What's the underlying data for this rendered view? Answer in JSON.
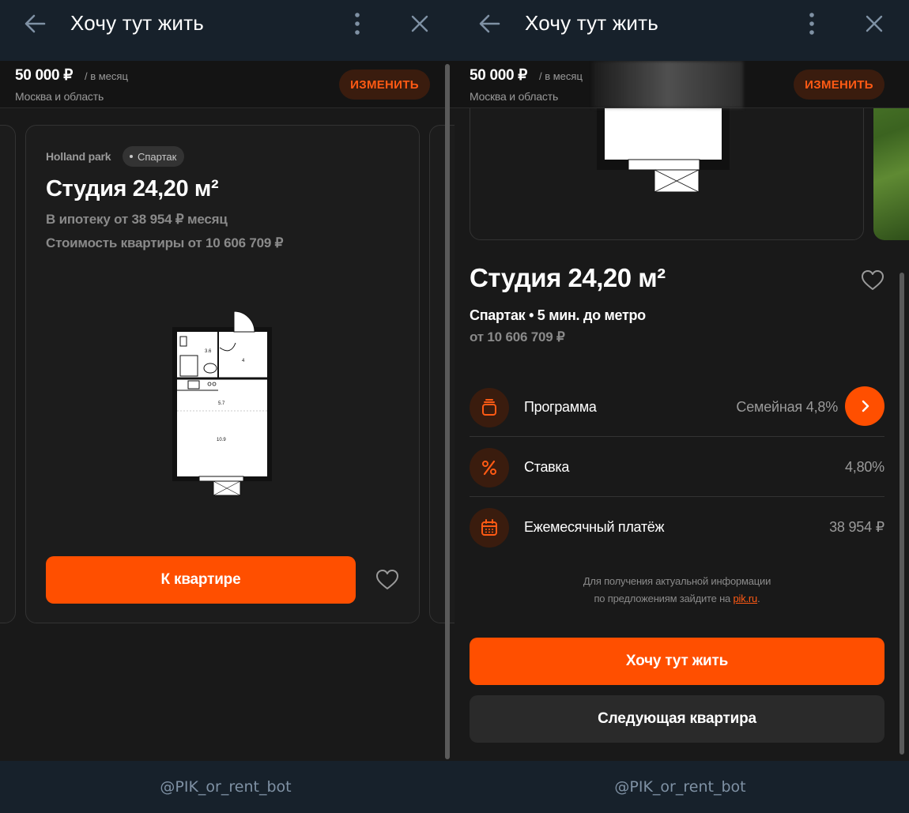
{
  "telegram": {
    "title": "Хочу тут жить",
    "bot_username": "@PIK_or_rent_bot"
  },
  "filter_bar": {
    "price": "50 000 ₽",
    "period": "/ в месяц",
    "region": "Москва и область",
    "change_label": "ИЗМЕНИТЬ"
  },
  "card": {
    "project": "Holland park",
    "metro": "Спартак",
    "title": "Студия 24,20 м²",
    "mortgage": "В ипотеку от 38 954 ₽ месяц",
    "cost": "Стоимость квартиры от 10 606 709 ₽",
    "plan_rooms": [
      "3.6",
      "4",
      "5.7",
      "10.9"
    ],
    "cta_label": "К квартире"
  },
  "detail": {
    "title": "Студия 24,20 м²",
    "subtitle": "Спартак • 5 мин. до метро",
    "price": "от 10 606 709 ₽",
    "rows": [
      {
        "label": "Программа",
        "value": "Семейная 4,8%",
        "icon": "program-icon"
      },
      {
        "label": "Ставка",
        "value": "4,80%",
        "icon": "percent-icon"
      },
      {
        "label": "Ежемесячный платёж",
        "value": "38 954 ₽",
        "icon": "calendar-icon"
      }
    ],
    "note_line1": "Для получения актуальной информации",
    "note_line2_prefix": "по предложениям зайдите на ",
    "note_link": "pik.ru",
    "note_suffix": ".",
    "cta_label": "Хочу тут жить",
    "next_label": "Следующая квартира"
  },
  "colors": {
    "accent": "#ff4f00",
    "accent_dark": "#3a1c0e",
    "background": "#191919",
    "telegram_bg": "#17212b"
  }
}
